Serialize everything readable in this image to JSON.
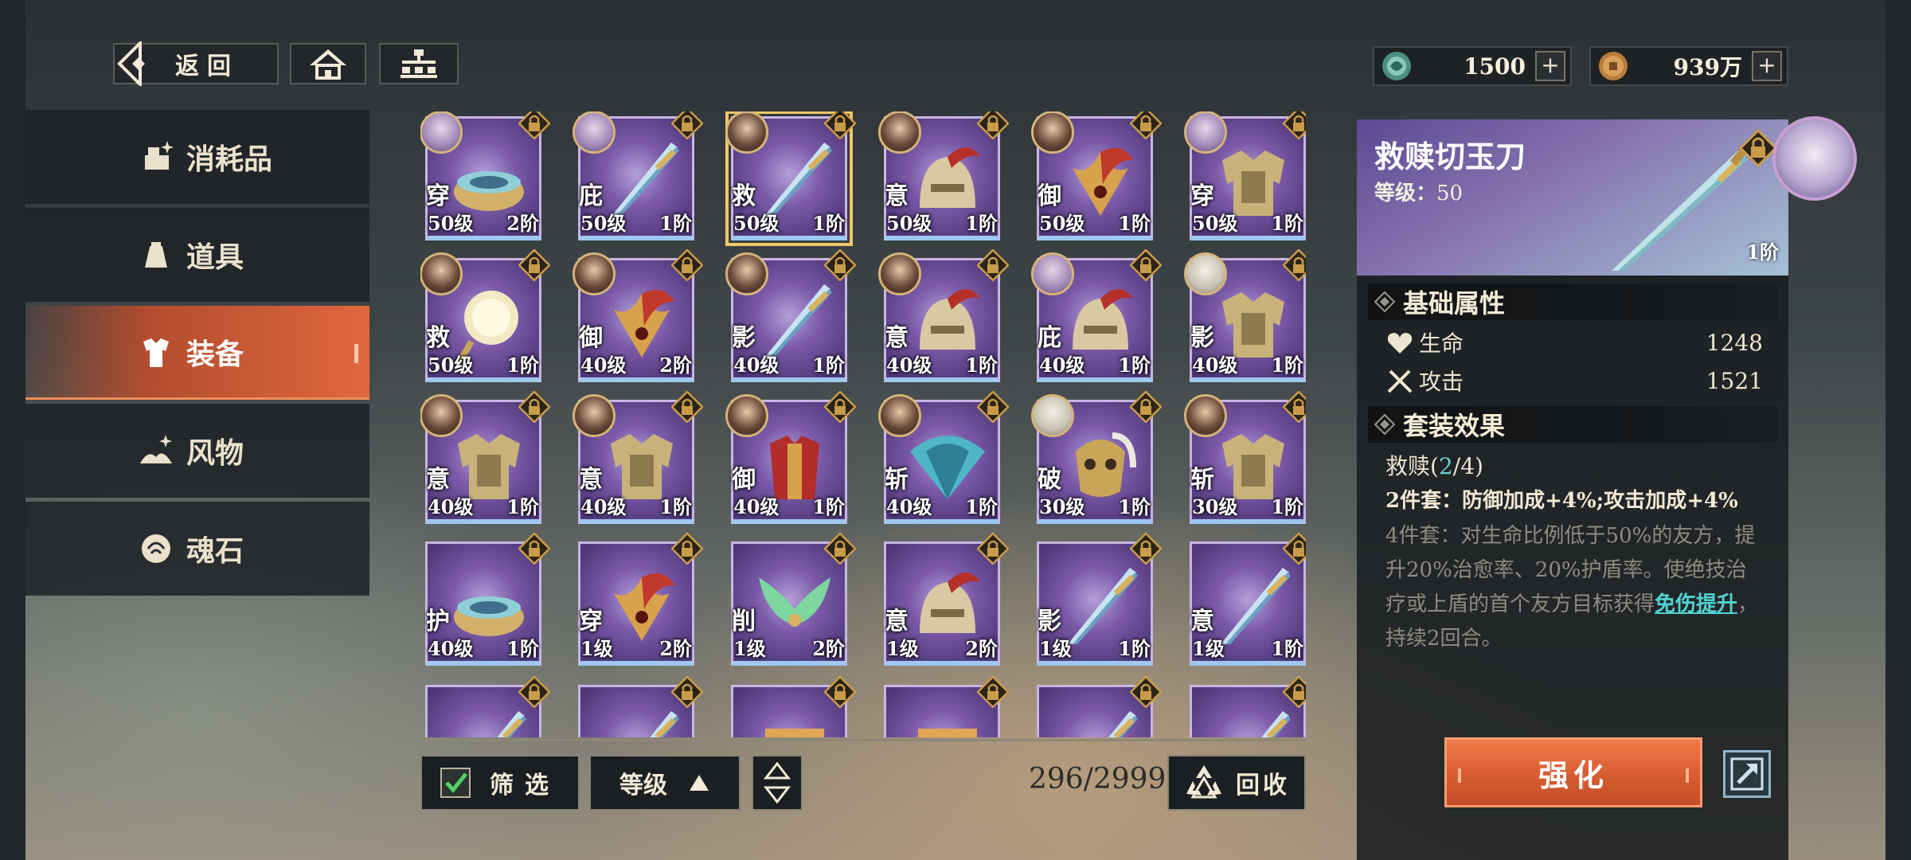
{
  "topbar": {
    "back_label": "返回",
    "currencies": [
      {
        "name": "jade",
        "value": "1500",
        "icon": "jade-token-icon",
        "plus": "+"
      },
      {
        "name": "coin",
        "value": "939万",
        "icon": "copper-coin-icon",
        "plus": "+"
      }
    ]
  },
  "sidebar": {
    "items": [
      {
        "label": "消耗品",
        "icon": "consumables-icon",
        "active": false
      },
      {
        "label": "道具",
        "icon": "props-bag-icon",
        "active": false
      },
      {
        "label": "装备",
        "icon": "equipment-armor-icon",
        "active": true
      },
      {
        "label": "风物",
        "icon": "scenery-icon",
        "active": false
      },
      {
        "label": "魂石",
        "icon": "soul-stone-icon",
        "active": false
      }
    ]
  },
  "grid": {
    "items": [
      {
        "tag": "穿",
        "level": "50级",
        "tier": "2阶",
        "item": "bowl",
        "avatar": "light",
        "selected": false
      },
      {
        "tag": "庇",
        "level": "50级",
        "tier": "1阶",
        "item": "sword",
        "avatar": "light",
        "selected": false
      },
      {
        "tag": "救",
        "level": "50级",
        "tier": "1阶",
        "item": "sword",
        "avatar": "dark",
        "selected": true
      },
      {
        "tag": "意",
        "level": "50级",
        "tier": "1阶",
        "item": "helmet",
        "avatar": "dark",
        "selected": false
      },
      {
        "tag": "御",
        "level": "50级",
        "tier": "1阶",
        "item": "crest",
        "avatar": "dark",
        "selected": false
      },
      {
        "tag": "穿",
        "level": "50级",
        "tier": "1阶",
        "item": "armor",
        "avatar": "light",
        "selected": false
      },
      {
        "tag": "救",
        "level": "50级",
        "tier": "1阶",
        "item": "mirror",
        "avatar": "dark",
        "selected": false
      },
      {
        "tag": "御",
        "level": "40级",
        "tier": "2阶",
        "item": "crest",
        "avatar": "dark",
        "selected": false
      },
      {
        "tag": "影",
        "level": "40级",
        "tier": "1阶",
        "item": "sword",
        "avatar": "dark",
        "selected": false
      },
      {
        "tag": "意",
        "level": "40级",
        "tier": "1阶",
        "item": "helmet",
        "avatar": "dark",
        "selected": false
      },
      {
        "tag": "庇",
        "level": "40级",
        "tier": "1阶",
        "item": "helmet",
        "avatar": "light",
        "selected": false
      },
      {
        "tag": "影",
        "level": "40级",
        "tier": "1阶",
        "item": "armor",
        "avatar": "pale",
        "selected": false
      },
      {
        "tag": "意",
        "level": "40级",
        "tier": "1阶",
        "item": "armor",
        "avatar": "dark",
        "selected": false
      },
      {
        "tag": "意",
        "level": "40级",
        "tier": "1阶",
        "item": "armor",
        "avatar": "dark",
        "selected": false
      },
      {
        "tag": "御",
        "level": "40级",
        "tier": "1阶",
        "item": "robe",
        "avatar": "dark",
        "selected": false
      },
      {
        "tag": "斩",
        "level": "40级",
        "tier": "1阶",
        "item": "fan",
        "avatar": "dark",
        "selected": false
      },
      {
        "tag": "破",
        "level": "30级",
        "tier": "1阶",
        "item": "mask",
        "avatar": "pale",
        "selected": false
      },
      {
        "tag": "斩",
        "level": "30级",
        "tier": "1阶",
        "item": "armor",
        "avatar": "dark",
        "selected": false
      },
      {
        "tag": "护",
        "level": "40级",
        "tier": "1阶",
        "item": "bowl",
        "avatar": "none",
        "selected": false
      },
      {
        "tag": "穿",
        "level": "1级",
        "tier": "2阶",
        "item": "crest",
        "avatar": "none",
        "selected": false
      },
      {
        "tag": "削",
        "level": "1级",
        "tier": "2阶",
        "item": "wings",
        "avatar": "none",
        "selected": false
      },
      {
        "tag": "意",
        "level": "1级",
        "tier": "2阶",
        "item": "helmet",
        "avatar": "none",
        "selected": false
      },
      {
        "tag": "影",
        "level": "1级",
        "tier": "1阶",
        "item": "sword",
        "avatar": "none",
        "selected": false
      },
      {
        "tag": "意",
        "level": "1级",
        "tier": "1阶",
        "item": "sword",
        "avatar": "none",
        "selected": false
      },
      {
        "tag": "",
        "level": "",
        "tier": "",
        "item": "sword",
        "avatar": "none",
        "selected": false
      },
      {
        "tag": "",
        "level": "",
        "tier": "",
        "item": "sword",
        "avatar": "none",
        "selected": false
      },
      {
        "tag": "",
        "level": "",
        "tier": "",
        "item": "chest",
        "avatar": "none",
        "selected": false
      },
      {
        "tag": "",
        "level": "",
        "tier": "",
        "item": "chest",
        "avatar": "none",
        "selected": false
      },
      {
        "tag": "",
        "level": "",
        "tier": "",
        "item": "sword",
        "avatar": "none",
        "selected": false
      },
      {
        "tag": "",
        "level": "",
        "tier": "",
        "item": "sword",
        "avatar": "none",
        "selected": false
      }
    ]
  },
  "controls": {
    "filter_label": "筛选",
    "filter_checked": true,
    "sort_label": "等级",
    "count": "296/2999",
    "recycle_label": "回收"
  },
  "detail": {
    "name": "救赎切玉刀",
    "level_label": "等级：",
    "level_value": "50",
    "tier": "1阶",
    "base_title": "基础属性",
    "stats": [
      {
        "label": "生命",
        "value": "1248",
        "icon": "heart-icon"
      },
      {
        "label": "攻击",
        "value": "1521",
        "icon": "crossed-swords-icon"
      }
    ],
    "set_title": "套装效果",
    "set_name": "救赎(",
    "set_count": "2",
    "set_total": "/4)",
    "set2_text": "2件套：防御加成+4%;攻击加成+4%",
    "set4_text": "4件套：对生命比例低于50%的友方，提升20%治愈率、20%护盾率。使绝技治疗或上盾的首个友方目标获得",
    "set4_keyword": "免伤提升",
    "set4_tail": "，持续2回合。",
    "enhance_label": "强化"
  }
}
